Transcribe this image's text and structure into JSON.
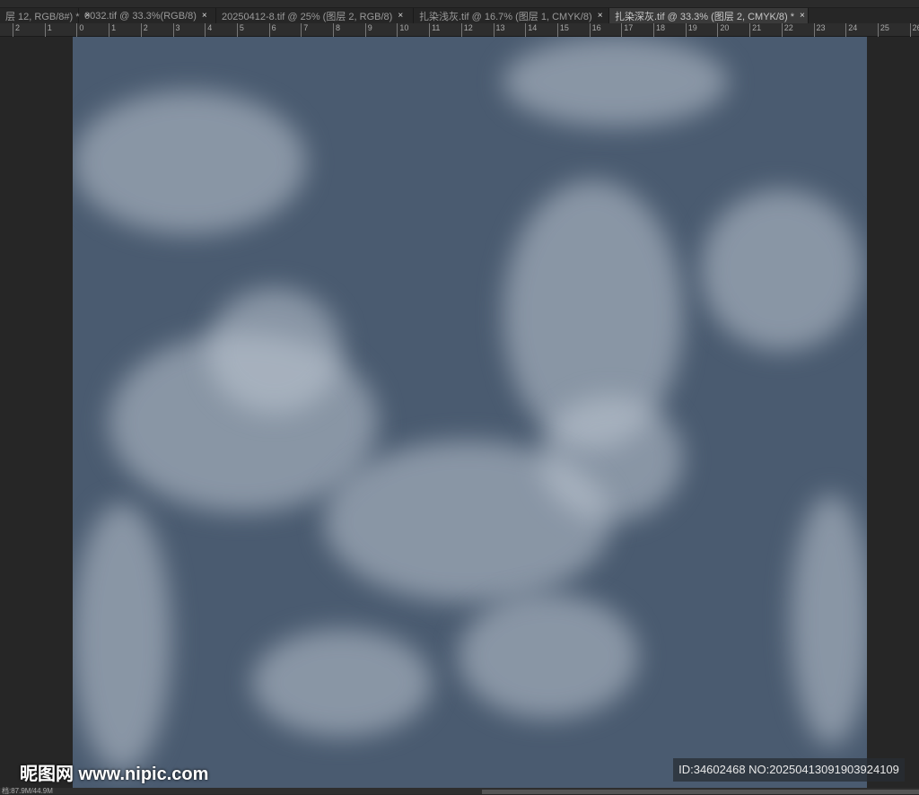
{
  "tabs": [
    {
      "label": "层 12, RGB/8#) *",
      "active": false
    },
    {
      "label": "0032.tif @ 33.3%(RGB/8)",
      "active": false
    },
    {
      "label": "20250412-8.tif @ 25% (图层 2, RGB/8)",
      "active": false
    },
    {
      "label": "扎染浅灰.tif @ 16.7% (图层 1, CMYK/8)",
      "active": false
    },
    {
      "label": "扎染深灰.tif @ 33.3% (图层 2, CMYK/8) *",
      "active": true
    }
  ],
  "close_glyph": "×",
  "ruler": [
    "2",
    "1",
    "0",
    "1",
    "2",
    "3",
    "4",
    "5",
    "6",
    "7",
    "8",
    "9",
    "10",
    "11",
    "12",
    "13",
    "14",
    "15",
    "16",
    "17",
    "18",
    "19",
    "20",
    "21",
    "22",
    "23",
    "24",
    "25",
    "26"
  ],
  "canvas_color": "#4a5b70",
  "watermark": {
    "logo": "昵图网 www.nipic.com",
    "id": "ID:34602468 NO:20250413091903924109"
  },
  "status": "档:87.9M/44.9M"
}
